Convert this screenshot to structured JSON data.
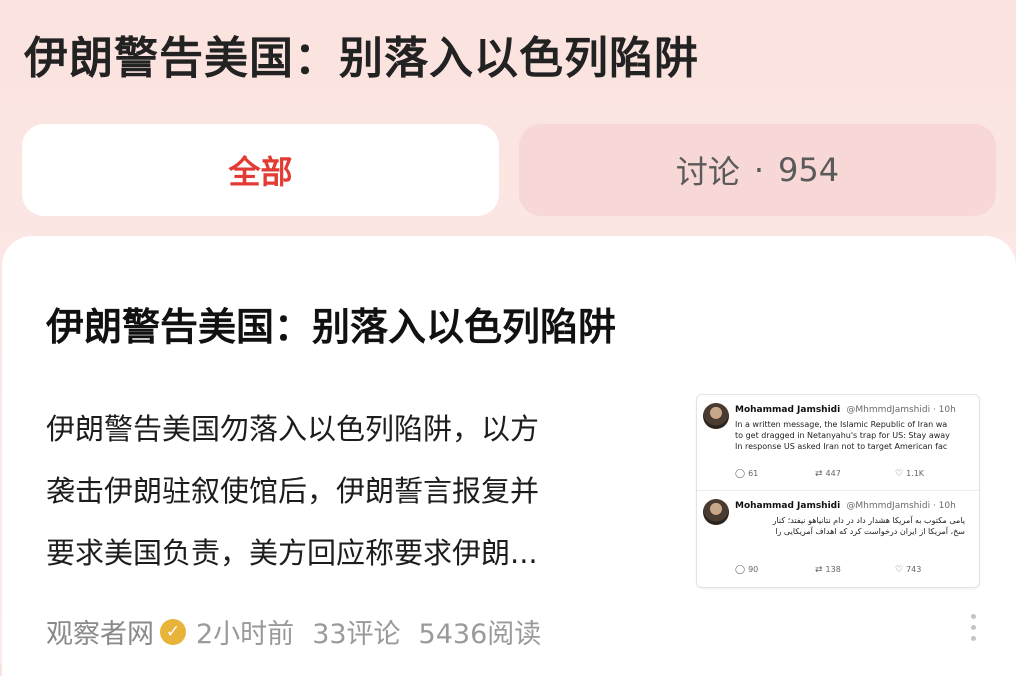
{
  "page": {
    "title": "伊朗警告美国：别落入以色列陷阱"
  },
  "tabs": {
    "all_label": "全部",
    "discuss_label": "讨论",
    "discuss_sep": "·",
    "discuss_count": "954"
  },
  "article": {
    "title": "伊朗警告美国：别落入以色列陷阱",
    "snippet_lines": [
      "伊朗警告美国勿落入以色列陷阱，以方",
      "袭击伊朗驻叙使馆后，伊朗誓言报复并",
      "要求美国负责，美方回应称要求伊朗..."
    ],
    "source": "观察者网",
    "time": "2小时前",
    "comments": "33评论",
    "reads": "5436阅读"
  },
  "thumbnail": {
    "tweets": [
      {
        "name": "Mohammad Jamshidi",
        "handle": "@MhmmdJamshidi · 10h",
        "lines": [
          "In a written message, the Islamic Republic of Iran wa",
          "to get dragged in Netanyahu's trap for US: Stay away",
          "In response US asked Iran not to target American fac"
        ],
        "replies": "61",
        "retweets": "447",
        "likes": "1.1K"
      },
      {
        "name": "Mohammad Jamshidi",
        "handle": "@MhmmdJamshidi · 10h",
        "lines": [
          "یامی مکتوب به آمریکا هشدار داد در دام نتانیاهو نیفتد؛ کنار",
          "سخ، آمریکا از ایران درخواست کرد که اهداف آمریکایی را"
        ],
        "replies": "90",
        "retweets": "138",
        "likes": "743"
      }
    ]
  },
  "colors": {
    "accent": "#e33b33",
    "tab_inactive_bg": "#f7d8d6",
    "verified": "#e8b339"
  },
  "icons": [
    "verified-icon",
    "more-icon",
    "reply-icon",
    "retweet-icon",
    "like-icon"
  ]
}
